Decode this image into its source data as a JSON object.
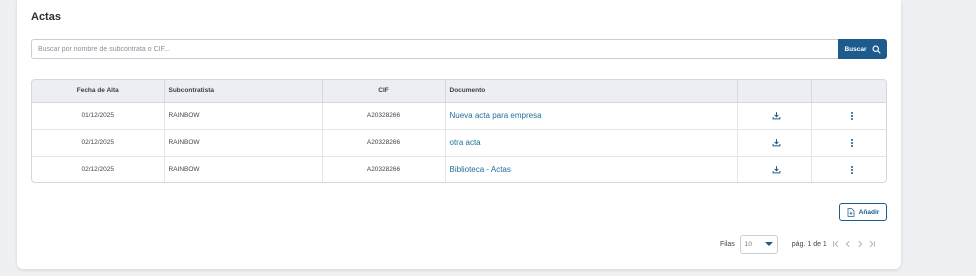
{
  "page": {
    "title": "Actas"
  },
  "search": {
    "placeholder": "Buscar por nombre de subcontrata o CIF...",
    "value": "",
    "button_label": "Buscar"
  },
  "table": {
    "headers": [
      "Fecha de Alta",
      "Subcontratista",
      "CIF",
      "Documento",
      "",
      ""
    ],
    "rows": [
      {
        "fecha": "01/12/2025",
        "subcontratista": "RAINBOW",
        "cif": "A20328266",
        "documento": "Nueva acta para empresa"
      },
      {
        "fecha": "02/12/2025",
        "subcontratista": "RAINBOW",
        "cif": "A20328266",
        "documento": "otra acta"
      },
      {
        "fecha": "02/12/2025",
        "subcontratista": "RAINBOW",
        "cif": "A20328266",
        "documento": "Biblioteca - Actas"
      }
    ],
    "row_icons": [
      "download-icon",
      "more-vertical-icon"
    ]
  },
  "actions": {
    "add_label": "Añadir"
  },
  "pagination": {
    "rows_label": "Filas",
    "rows_value": "10",
    "page_info": "pág. 1 de 1"
  },
  "colors": {
    "primary": "#1d5b8d",
    "link": "#1d6f9a",
    "header_bg": "#eceef3",
    "page_bg": "#eef0f3"
  }
}
